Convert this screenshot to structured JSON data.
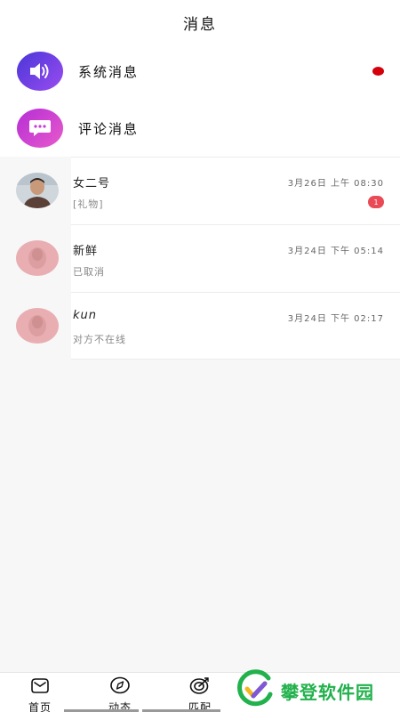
{
  "header": {
    "title": "消息"
  },
  "system_rows": [
    {
      "label": "系统消息",
      "icon": "speaker-icon",
      "has_unread_dot": true,
      "icon_colors": [
        "#5b3ee0",
        "#8a44e8"
      ]
    },
    {
      "label": "评论消息",
      "icon": "chat-bubble-icon",
      "has_unread_dot": false,
      "icon_colors": [
        "#c63ad9",
        "#e04fc9"
      ]
    }
  ],
  "conversations": [
    {
      "name": "女二号",
      "time": "3月26日 上午 08:30",
      "preview": "[礼物]",
      "badge": "1",
      "avatar": "photo-avatar"
    },
    {
      "name": "新鲜",
      "time": "3月24日 下午 05:14",
      "preview": "已取消",
      "badge": "",
      "avatar": "blurred-avatar"
    },
    {
      "name": "kun",
      "time": "3月24日 下午 02:17",
      "preview": "对方不在线",
      "badge": "",
      "avatar": "blurred-avatar"
    }
  ],
  "tabbar": {
    "tabs": [
      {
        "label": "首页",
        "icon": "home-icon"
      },
      {
        "label": "动态",
        "icon": "compass-icon"
      },
      {
        "label": "匹配",
        "icon": "target-icon"
      }
    ]
  },
  "watermark": {
    "text": "攀登软件园",
    "color": "#22b14c"
  },
  "colors": {
    "unread_dot": "#d4000b",
    "badge": "#e94a55"
  }
}
